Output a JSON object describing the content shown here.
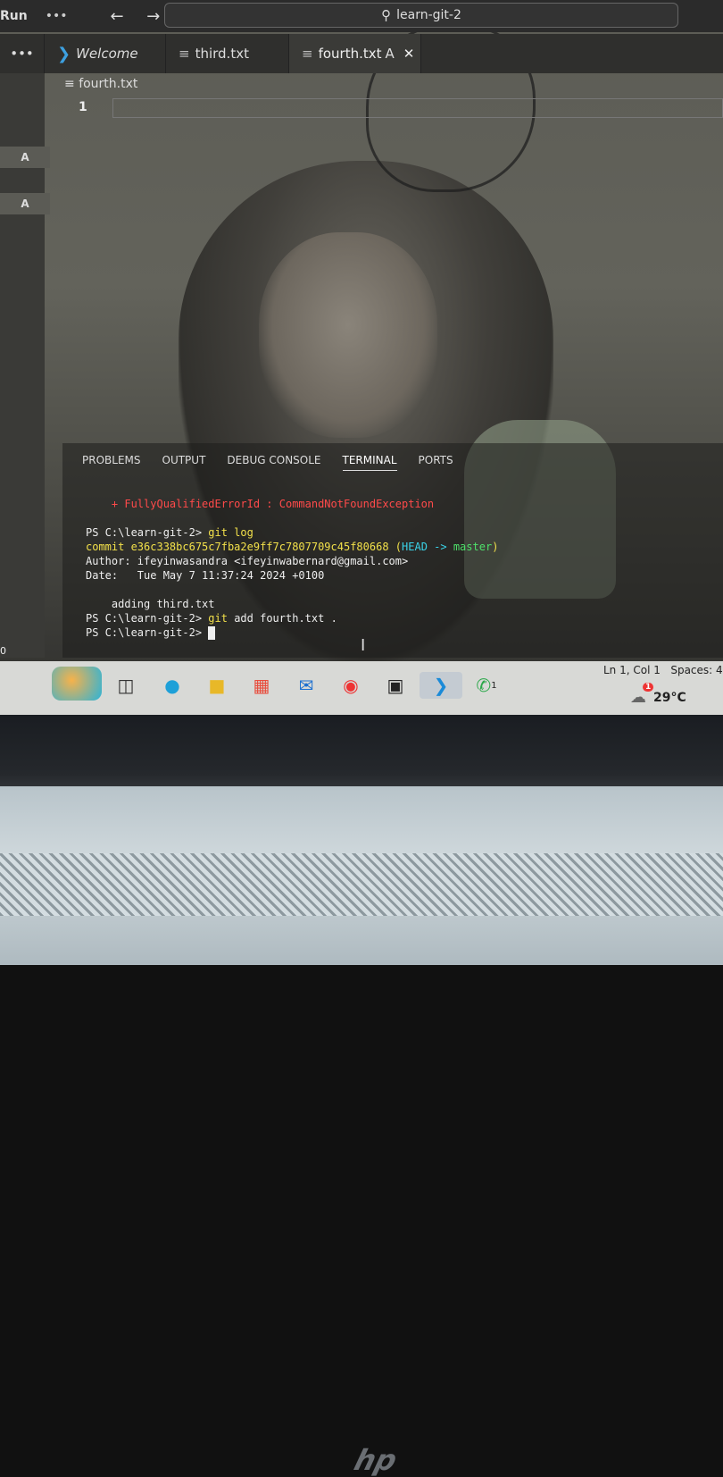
{
  "titlebar": {
    "menu_label": "Run",
    "more": "•••",
    "nav_arrows": "← →",
    "search_text": "learn-git-2"
  },
  "activity": {
    "more": "•••",
    "badges": [
      "A",
      "A"
    ]
  },
  "tabs": [
    {
      "label": "Welcome",
      "icon": "vscode-icon"
    },
    {
      "label": "third.txt",
      "icon": "file-lines-icon"
    },
    {
      "label": "fourth.txt",
      "icon": "file-lines-icon",
      "status": "A",
      "close": "✕"
    }
  ],
  "editor": {
    "breadcrumb": "fourth.txt",
    "line_number": "1"
  },
  "panel": {
    "tabs": [
      "PROBLEMS",
      "OUTPUT",
      "DEBUG CONSOLE",
      "TERMINAL",
      "PORTS"
    ],
    "active_tab": "TERMINAL"
  },
  "terminal": {
    "error_line": "    + FullyQualifiedErrorId : CommandNotFoundException",
    "prompt1": "PS C:\\learn-git-2> ",
    "cmd1": "git log",
    "commit_prefix": "commit e36c338bc675c7fba2e9ff7c7807709c45f80668 (",
    "head": "HEAD",
    "arrow": " -> ",
    "branch": "master",
    "commit_suffix": ")",
    "author": "Author: ifeyinwasandra <ifeyinwabernard@gmail.com>",
    "date": "Date:   Tue May 7 11:37:24 2024 +0100",
    "message": "    adding third.txt",
    "prompt2": "PS C:\\learn-git-2> ",
    "cmd2_git": "git",
    "cmd2_rest": " add fourth.txt .",
    "prompt3": "PS C:\\learn-git-2> "
  },
  "status": {
    "left": "0",
    "position": "Ln 1, Col 1",
    "spaces": "Spaces: 4"
  },
  "taskbar": {
    "icons": [
      "beach-widget-icon",
      "task-view-icon",
      "edge-icon",
      "file-explorer-icon",
      "store-icon",
      "mail-icon",
      "chrome-icon",
      "terminal-icon",
      "vscode-icon",
      "whatsapp-icon"
    ],
    "whatsapp_badge": "1",
    "weather_badge": "1",
    "temperature": "29°C"
  },
  "laptop": {
    "logo": "hp"
  }
}
